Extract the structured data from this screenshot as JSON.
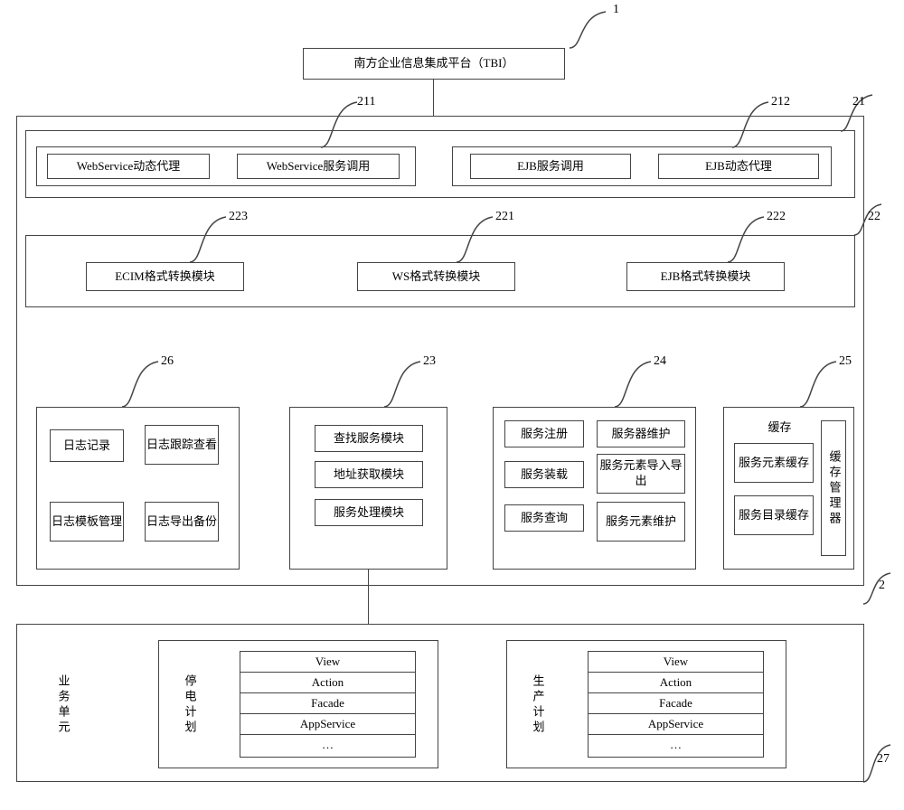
{
  "top": {
    "title": "南方企业信息集成平台（TBI）"
  },
  "labels": {
    "l1": "1",
    "l21": "21",
    "l211": "211",
    "l212": "212",
    "l22": "22",
    "l221": "221",
    "l222": "222",
    "l223": "223",
    "l23": "23",
    "l24": "24",
    "l25": "25",
    "l26": "26",
    "l2": "2",
    "l27": "27"
  },
  "row21": {
    "a": "WebService动态代理",
    "b": "WebService服务调用",
    "c": "EJB服务调用",
    "d": "EJB动态代理"
  },
  "row22": {
    "a": "ECIM格式转换模块",
    "b": "WS格式转换模块",
    "c": "EJB格式转换模块"
  },
  "g23": {
    "a": "查找服务模块",
    "b": "地址获取模块",
    "c": "服务处理模块"
  },
  "g24": {
    "a": "服务注册",
    "b": "服务器维护",
    "c": "服务装载",
    "d": "服务元素导入导出",
    "e": "服务查询",
    "f": "服务元素维护"
  },
  "g25": {
    "title": "缓存",
    "a": "服务元素缓存",
    "b": "服务目录缓存",
    "mgr": "缓存管理器"
  },
  "g26": {
    "a": "日志记录",
    "b": "日志跟踪查看",
    "c": "日志模板管理",
    "d": "日志导出备份"
  },
  "g27": {
    "unit": "业务单元",
    "plan1": "停电计划",
    "plan2": "生产计划",
    "s1": "View",
    "s2": "Action",
    "s3": "Facade",
    "s4": "AppService",
    "s5": "…"
  }
}
